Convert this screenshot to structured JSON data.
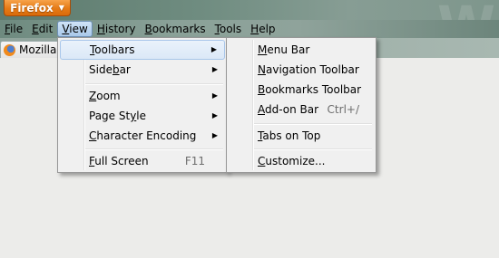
{
  "app": {
    "button_label": "Firefox",
    "button_arrow": "▼"
  },
  "menubar": [
    {
      "label": "File",
      "ul": "F",
      "rest": "ile"
    },
    {
      "label": "Edit",
      "ul": "E",
      "rest": "dit"
    },
    {
      "label": "View",
      "ul": "V",
      "rest": "iew"
    },
    {
      "label": "History",
      "ul": "H",
      "rest": "istory"
    },
    {
      "label": "Bookmarks",
      "ul": "B",
      "rest": "ookmarks"
    },
    {
      "label": "Tools",
      "ul": "T",
      "rest": "ools"
    },
    {
      "label": "Help",
      "ul": "H",
      "rest": "elp"
    }
  ],
  "tab": {
    "label": "Mozilla",
    "icon": "firefox-icon"
  },
  "view_menu": {
    "toolbars": {
      "pre": "",
      "ul": "T",
      "post": "oolbars"
    },
    "sidebar": {
      "pre": "Side",
      "ul": "b",
      "post": "ar"
    },
    "zoom": {
      "pre": "",
      "ul": "Z",
      "post": "oom"
    },
    "page_style": {
      "pre": "Page St",
      "ul": "y",
      "post": "le"
    },
    "character_encoding": {
      "pre": "",
      "ul": "C",
      "post": "haracter Encoding"
    },
    "full_screen": {
      "pre": "",
      "ul": "F",
      "post": "ull Screen"
    },
    "full_screen_shortcut": "F11",
    "submenu_arrow": "▶"
  },
  "toolbars_menu": {
    "menu_bar": {
      "pre": "",
      "ul": "M",
      "post": "enu Bar"
    },
    "navigation_toolbar": {
      "pre": "",
      "ul": "N",
      "post": "avigation Toolbar"
    },
    "bookmarks_toolbar": {
      "pre": "",
      "ul": "B",
      "post": "ookmarks Toolbar"
    },
    "addon_bar": {
      "pre": "",
      "ul": "A",
      "post": "dd-on Bar"
    },
    "addon_bar_shortcut": "Ctrl+/",
    "tabs_on_top": {
      "pre": "",
      "ul": "T",
      "post": "abs on Top"
    },
    "customize": {
      "pre": "",
      "ul": "C",
      "post": "ustomize..."
    }
  }
}
